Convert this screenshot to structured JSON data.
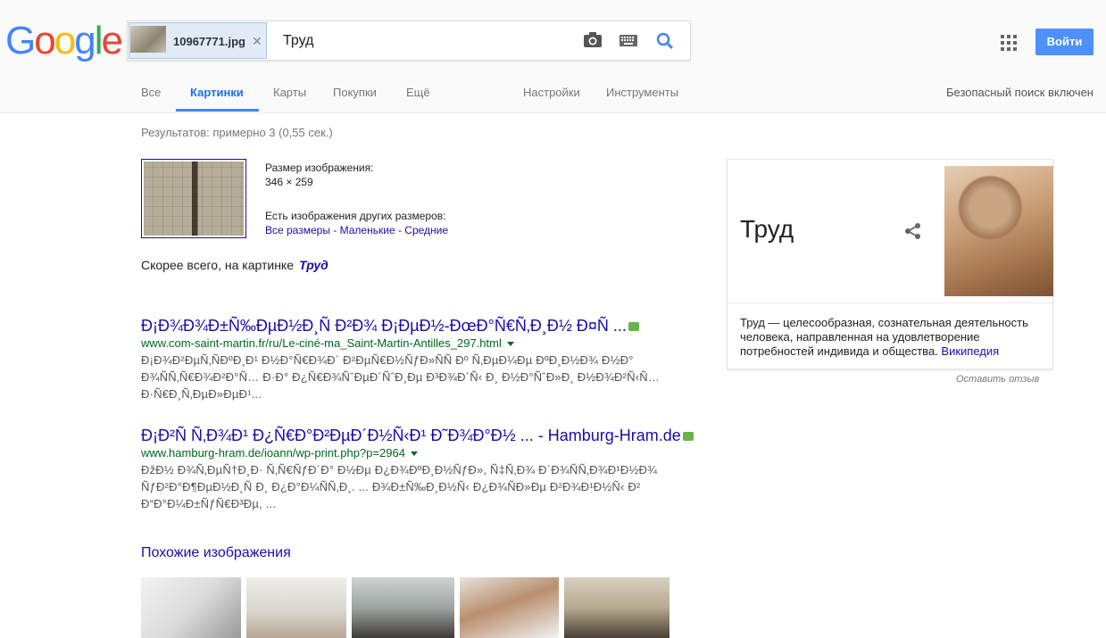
{
  "logo": {
    "letters": [
      "G",
      "o",
      "o",
      "g",
      "l",
      "e"
    ],
    "colors": [
      "#4285f4",
      "#ea4335",
      "#fbbc05",
      "#4285f4",
      "#34a853",
      "#ea4335"
    ]
  },
  "search": {
    "chip_filename": "10967771.jpg",
    "query": "Труд"
  },
  "header": {
    "signin_label": "Войти"
  },
  "nav": {
    "items": [
      "Все",
      "Картинки",
      "Карты",
      "Покупки",
      "Ещё"
    ],
    "settings": "Настройки",
    "tools": "Инструменты",
    "safe_search": "Безопасный поиск включен"
  },
  "stats": "Результатов: примерно 3 (0,55 сек.)",
  "image_info": {
    "size_label": "Размер изображения:",
    "size_value": "346 × 259",
    "other_sizes_label": "Есть изображения других размеров:",
    "all_sizes": "Все размеры",
    "sep1": " - ",
    "small": "Маленькие",
    "sep2": " - ",
    "medium": "Средние"
  },
  "best_guess": {
    "label": "Скорее всего, на картинке",
    "term": "Труд"
  },
  "results": [
    {
      "title": "Ð¡Ð¾Ð¾Ð±Ñ‰ÐµÐ½Ð¸Ñ Ð²Ð¾ Ð¡ÐµÐ½-ÐœÐ°Ñ€Ñ‚Ð¸Ð½ Ð¤Ñ ...",
      "url": "www.com-saint-martin.fr/ru/Le-ciné-ma_Saint-Martin-Antilles_297.html",
      "snippet": "Ð¡Ð¾Ð²ÐµÑ‚ÑÐºÐ¸Ð¹ Ð½Ð°Ñ€Ð¾Ð´ Ð²ÐµÑ€Ð½ÑƒÐ»ÑÑ Ðº Ñ‚ÐµÐ¼Ðµ ÐºÐ¸Ð½Ð¾ Ð½Ð° Ð¾ÑÑ‚Ñ€Ð¾Ð²Ð°Ñ… Ð·Ð° Ð¿Ñ€Ð¾ÑˆÐµÐ´ÑˆÐ¸Ðµ Ð³Ð¾Ð´Ñ‹ Ð¸ Ð½Ð°ÑˆÐ»Ð¸ Ð½Ð¾Ð²Ñ‹Ñ… Ð·Ñ€Ð¸Ñ‚ÐµÐ»ÐµÐ¹..."
    },
    {
      "title": "Ð¡Ð²Ñ Ñ‚Ð¾Ð¹ Ð¿Ñ€Ð°Ð²ÐµÐ´Ð½Ñ‹Ð¹ Ð˜Ð¾Ð°Ð½ ... - Hamburg-Hram.de",
      "url": "www.hamburg-hram.de/ioann/wp-print.php?p=2964",
      "snippet": "ÐžÐ½ Ð¾Ñ‚ÐµÑ†Ð¸Ð· Ñ‚Ñ€ÑƒÐ´Ð° Ð½Ðµ Ð¿Ð¾ÐºÐ¸Ð½ÑƒÐ», Ñ‡Ñ‚Ð¾ Ð´Ð¾ÑÑ‚Ð¾Ð¹Ð½Ð¾ ÑƒÐ²Ð°Ð¶ÐµÐ½Ð¸Ñ Ð¸ Ð¿Ð°Ð¼ÑÑ‚Ð¸. ... Ð¾Ð±Ñ‰Ð¸Ð½Ñ‹ Ð¿Ð¾ÑÐ»Ðµ Ð²Ð¾Ð¹Ð½Ñ‹ Ð² Ð“Ð°Ð¼Ð±ÑƒÑ€Ð³Ðµ, ..."
    }
  ],
  "similar": {
    "heading": "Похожие изображения"
  },
  "knowledge_panel": {
    "title": "Труд",
    "description": "Труд — целесообразная, сознательная деятельность человека, направленная на удовлетворение потребностей индивида и общества. ",
    "source": "Википедия"
  },
  "feedback": "Оставить отзыв",
  "colors": {
    "link": "#1a0dab",
    "url_green": "#006621",
    "accent_blue": "#4285f4",
    "signin_blue": "#4d90fe"
  }
}
